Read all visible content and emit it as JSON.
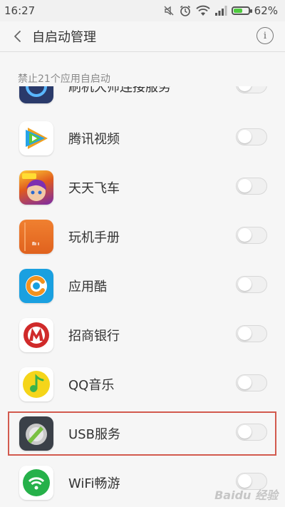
{
  "status_bar": {
    "time": "16:27",
    "battery_percent": "62%",
    "battery_level": 0.62,
    "icons": [
      "mute-icon",
      "alarm-icon",
      "wifi-icon",
      "signal-icon",
      "battery-icon"
    ]
  },
  "header": {
    "title": "自启动管理",
    "back_icon": "back-arrow-icon",
    "info_icon": "info-icon",
    "info_glyph": "i"
  },
  "section": {
    "label": "禁止21个应用自启动"
  },
  "apps": [
    {
      "name": "刷机大师连接服务",
      "enabled": false,
      "icon": "shuaji-icon"
    },
    {
      "name": "腾讯视频",
      "enabled": false,
      "icon": "tencent-video-icon"
    },
    {
      "name": "天天飞车",
      "enabled": false,
      "icon": "tiantian-feiche-icon"
    },
    {
      "name": "玩机手册",
      "enabled": false,
      "icon": "mi-manual-icon"
    },
    {
      "name": "应用酷",
      "enabled": false,
      "icon": "yingyongku-icon"
    },
    {
      "name": "招商银行",
      "enabled": false,
      "icon": "cmb-icon"
    },
    {
      "name": "QQ音乐",
      "enabled": false,
      "icon": "qq-music-icon"
    },
    {
      "name": "USB服务",
      "enabled": false,
      "icon": "usb-service-icon"
    },
    {
      "name": "WiFi畅游",
      "enabled": false,
      "icon": "wifi-changyou-icon"
    }
  ],
  "annotation": {
    "highlighted_item": "USB服务",
    "color": "#d25a4e"
  },
  "watermark": "Baidu 经验",
  "colors": {
    "battery_green": "#4ecb3e",
    "background": "#f6f6f6"
  }
}
